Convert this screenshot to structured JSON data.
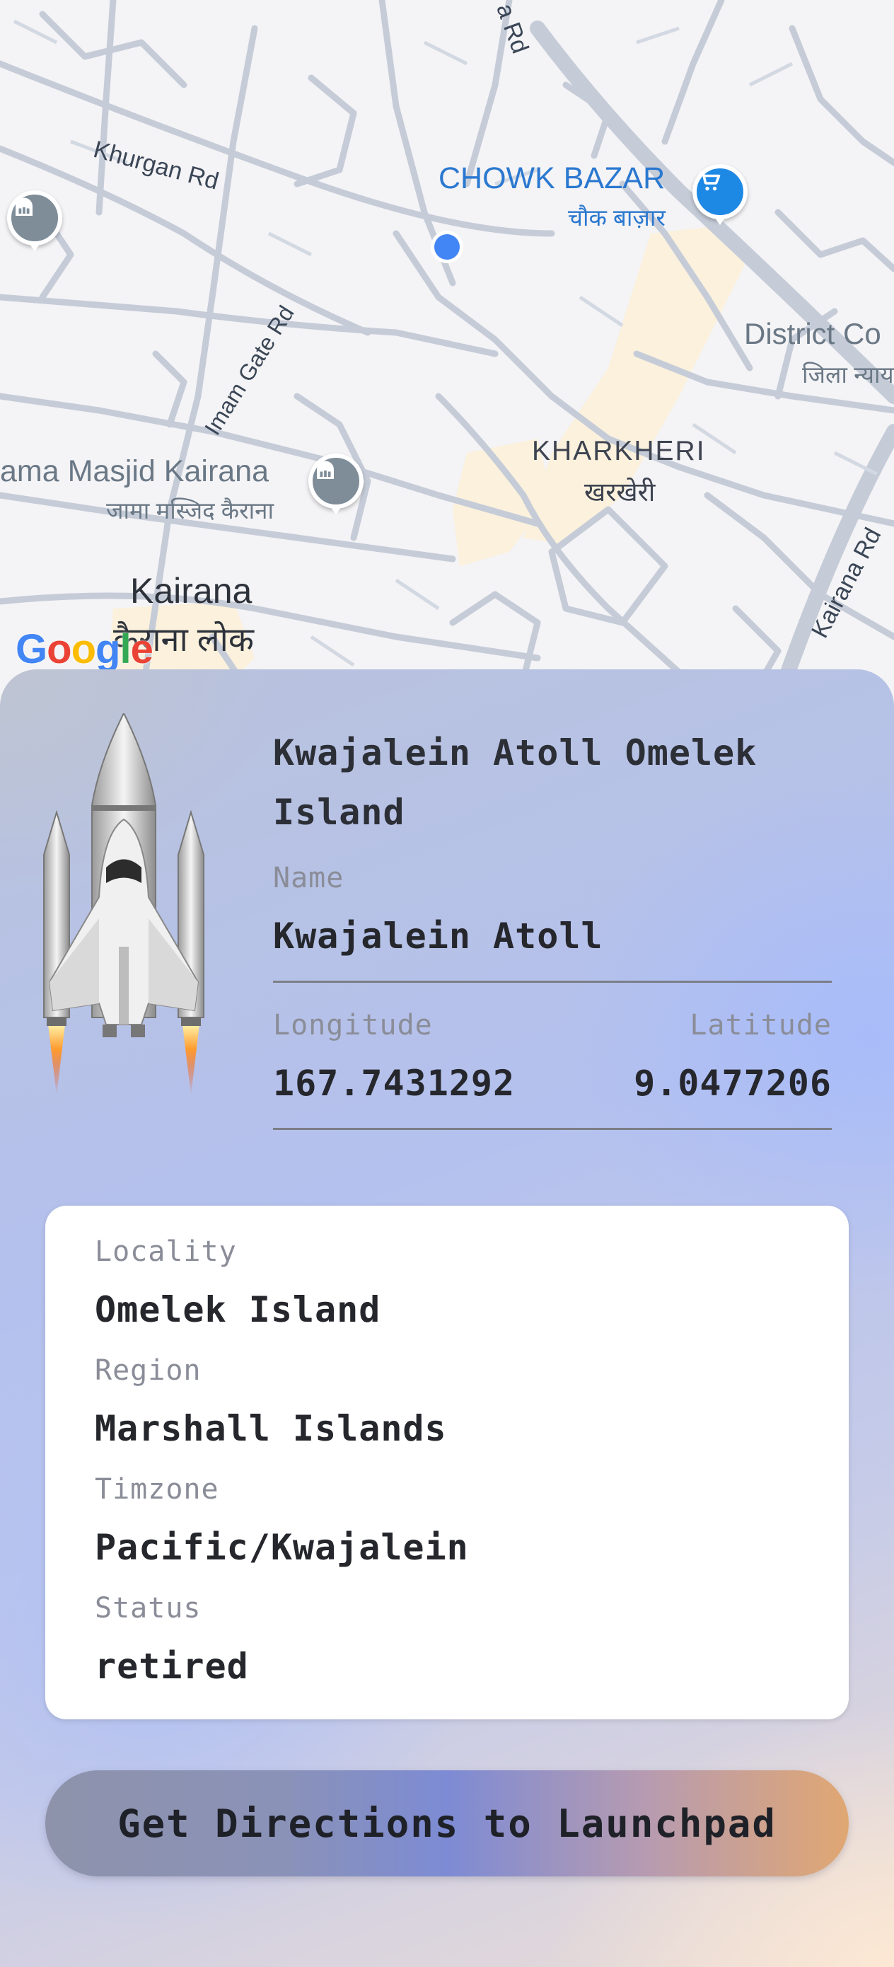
{
  "map": {
    "poi_bazar_en": "CHOWK BAZAR",
    "poi_bazar_hi": "चौक बाज़ार",
    "road_khurgan": "Khurgan Rd",
    "road_imam_gate": "Imam Gate Rd",
    "road_kairana": "Kairana Rd",
    "road_top": "a Rd",
    "area_kharkheri_en": "KHARKHERI",
    "area_kharkheri_hi": "खरखेरी",
    "district_en": "District Co",
    "district_hi": "जिला न्याय",
    "masjid_en": "ama Masjid Kairana",
    "masjid_hi": "जामा मस्जिद कैराना",
    "kairana_en": "Kairana",
    "kairana_hi": "कैराना लोक",
    "attribution": "Google",
    "colors": {
      "road": "#c5ccd8",
      "land": "#f4f3f5",
      "park": "#fbf1dc",
      "poi_blue": "#1e88e5",
      "poi_gray": "#7f8d99",
      "label_blue": "#2a78d0",
      "location_dot": "#4285f4"
    },
    "icons": [
      "cart-icon",
      "landmark-icon",
      "location-dot-icon"
    ]
  },
  "launchpad": {
    "title": "Kwajalein Atoll Omelek Island",
    "name_label": "Name",
    "name": "Kwajalein Atoll",
    "longitude_label": "Longitude",
    "longitude": "167.7431292",
    "latitude_label": "Latitude",
    "latitude": "9.0477206",
    "image": "space-shuttle-icon"
  },
  "details": {
    "locality_label": "Locality",
    "locality": "Omelek Island",
    "region_label": "Region",
    "region": "Marshall Islands",
    "timezone_label": "Timzone",
    "timezone": "Pacific/Kwajalein",
    "status_label": "Status",
    "status": "retired"
  },
  "actions": {
    "directions_label": "Get Directions to Launchpad"
  }
}
